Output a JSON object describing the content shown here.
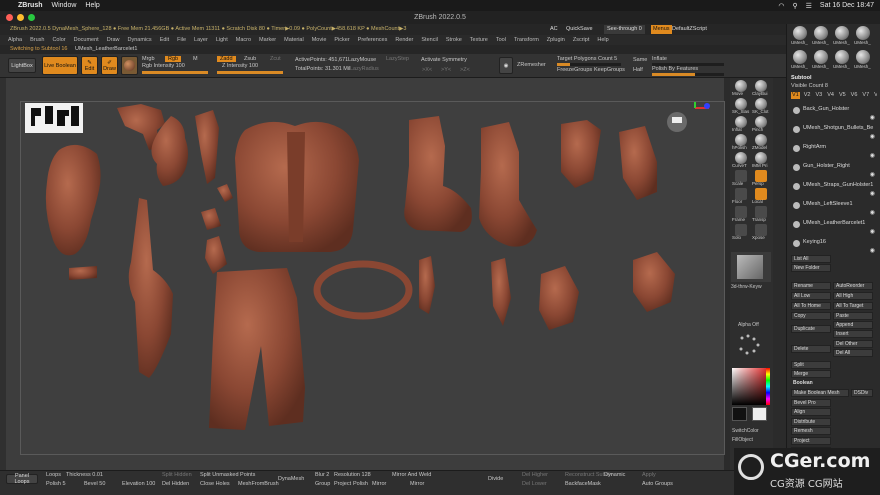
{
  "mac": {
    "app": "ZBrush",
    "menus": [
      "Window",
      "Help"
    ],
    "date": "Sat 16 Dec 18:47"
  },
  "window": {
    "title": "ZBrush 2022.0.5"
  },
  "infobar": {
    "text": "ZBrush 2022.0.5 DynaMesh_Sphere_128  ● Free Mem 21.456GB ● Active Mem 11311 ● Scratch Disk 80 ● Timer▶0.09 ● PolyCount▶458.618 KP ● MeshCount▶3",
    "ac": "AC",
    "quicksave": "QuickSave",
    "seethrough": "See-through  0",
    "menus_btn": "Menus",
    "script": "DefaultZScript"
  },
  "menubar": [
    "Alpha",
    "Brush",
    "Color",
    "Document",
    "Draw",
    "Dynamics",
    "Edit",
    "File",
    "Layer",
    "Light",
    "Macro",
    "Marker",
    "Material",
    "Movie",
    "Picker",
    "Preferences",
    "Render",
    "Stencil",
    "Stroke",
    "Texture",
    "Tool",
    "Transform",
    "Zplugin",
    "Zscript",
    "Help"
  ],
  "subbar": {
    "notice": "Switching to Subtool 16",
    "subtool": "UMesh_LeatherBarcelet1"
  },
  "toolshelf": {
    "lightbox": "LightBox",
    "live_boolean": "Live Boolean",
    "edit": "Edit",
    "draw": "Draw",
    "mrgb": "Mrgb",
    "rgb": "Rgb",
    "m": "M",
    "zadd": "Zadd",
    "zsub": "Zsub",
    "zcut": "Zcut",
    "rgb_intensity": "Rgb Intensity 100",
    "z_intensity": "Z Intensity 100",
    "active_points": "ActivePoints: 451,671",
    "total_points": "TotalPoints: 31.301 Mil",
    "lazymouse": "LazyMouse",
    "lazystep": "LazyStep",
    "lazyradius": "LazyRadius",
    "activate_symmetry": "Activate Symmetry",
    "sym_x": ">X<",
    "sym_y": ">Y<",
    "sym_z": ">Z<",
    "zremesher": "ZRemesher",
    "target_polygons": "Target Polygons Count 5",
    "freeze_groups": "FreezeGroups",
    "keep_groups": "KeepGroups",
    "same": "Same",
    "half": "Half",
    "inflate": "Inflate",
    "polish_by_features": "Polish By Features"
  },
  "rightshelf": [
    "Move",
    "ClayBui",
    "SK_Slas",
    "SK_Clot",
    "Inflat",
    "Pinch",
    "hPolish",
    "ZModel",
    "CurveT",
    "IMM Pri",
    "Scale",
    "Persp",
    "Floor",
    "Local",
    "Frame",
    "Transp",
    "Solo",
    "Xpose"
  ],
  "sidepanel": {
    "thumbs": [
      "UMesh_",
      "UMesh_",
      "UMesh_",
      "UMesh_",
      "UMesh_",
      "UMesh_",
      "UMesh_",
      "UMesh_"
    ],
    "subtool_title": "Subtool",
    "visible_count": "Visible Count 8",
    "versions": [
      "V1",
      "V2",
      "V3",
      "V4",
      "V5",
      "V6",
      "V7",
      "V8"
    ],
    "subtools": [
      "Back_Gun_Holster",
      "UMesh_Shotgun_Bullets_Be",
      "RightArm",
      "Gun_Holster_Right",
      "UMesh_Straps_GunHolster1",
      "UMesh_LeftSleeve1",
      "UMesh_LeatherBarcelet1",
      "Keying16"
    ],
    "list_all": "List All",
    "new_folder": "New Folder",
    "rename": "Rename",
    "autoreorder": "AutoReorder",
    "all_low": "All Low",
    "all_high": "All High",
    "all_to_home": "All To Home",
    "all_to_target": "All To Target",
    "copy": "Copy",
    "paste": "Paste",
    "duplicate": "Duplicate",
    "append": "Append",
    "insert": "Insert",
    "delete": "Delete",
    "del_other": "Del Other",
    "del_all": "Del All",
    "split": "Split",
    "merge": "Merge",
    "boolean": "Boolean",
    "make_boolean_mesh": "Make Boolean Mesh",
    "dsdiv": "DSDiv",
    "bevel_pro": "Bevel Pro",
    "align": "Align",
    "distribute": "Distribute",
    "remesh": "Remesh",
    "project": "Project",
    "extract": "Extract"
  },
  "leftpanel": {
    "alpha_label": "Alpha Off",
    "brush_label": "3d-thrw-Keyw",
    "switchcolor": "SwitchColor",
    "fillobject": "FillObject"
  },
  "bottombar": {
    "panel_loops": "Panel Loops",
    "loops": "Loops",
    "thickness": "Thickness 0.01",
    "polish": "Polish 5",
    "bevel": "Bevel 50",
    "elevation": "Elevation 100",
    "split_hidden": "Split Hidden",
    "del_hidden": "Del Hidden",
    "split_unmasked": "Split Unmasked Points",
    "close_holes": "Close Holes",
    "mesh_from_brush": "MeshFromBrush",
    "dynamesh": "DynaMesh",
    "blur": "Blur 2",
    "resolution": "Resolution 128",
    "group": "Group",
    "project": "Project",
    "polish2": "Polish",
    "mirror_and_weld": "Mirror And Weld",
    "mirror": "Mirror",
    "divide": "Divide",
    "del_higher": "Del Higher",
    "del_lower": "Del Lower",
    "reconstruct": "Reconstruct Subdiv",
    "backface_mask": "BackfaceMask",
    "dynamic": "Dynamic",
    "apply": "Apply",
    "auto_groups": "Auto Groups"
  },
  "watermark": {
    "main": "CGer.com",
    "sub": "CG资源  CG网站"
  },
  "colors": {
    "accent": "#e08a1e",
    "clay": "#8a4733",
    "clay_light": "#a65a42",
    "viewport": "#3f3f3f"
  }
}
